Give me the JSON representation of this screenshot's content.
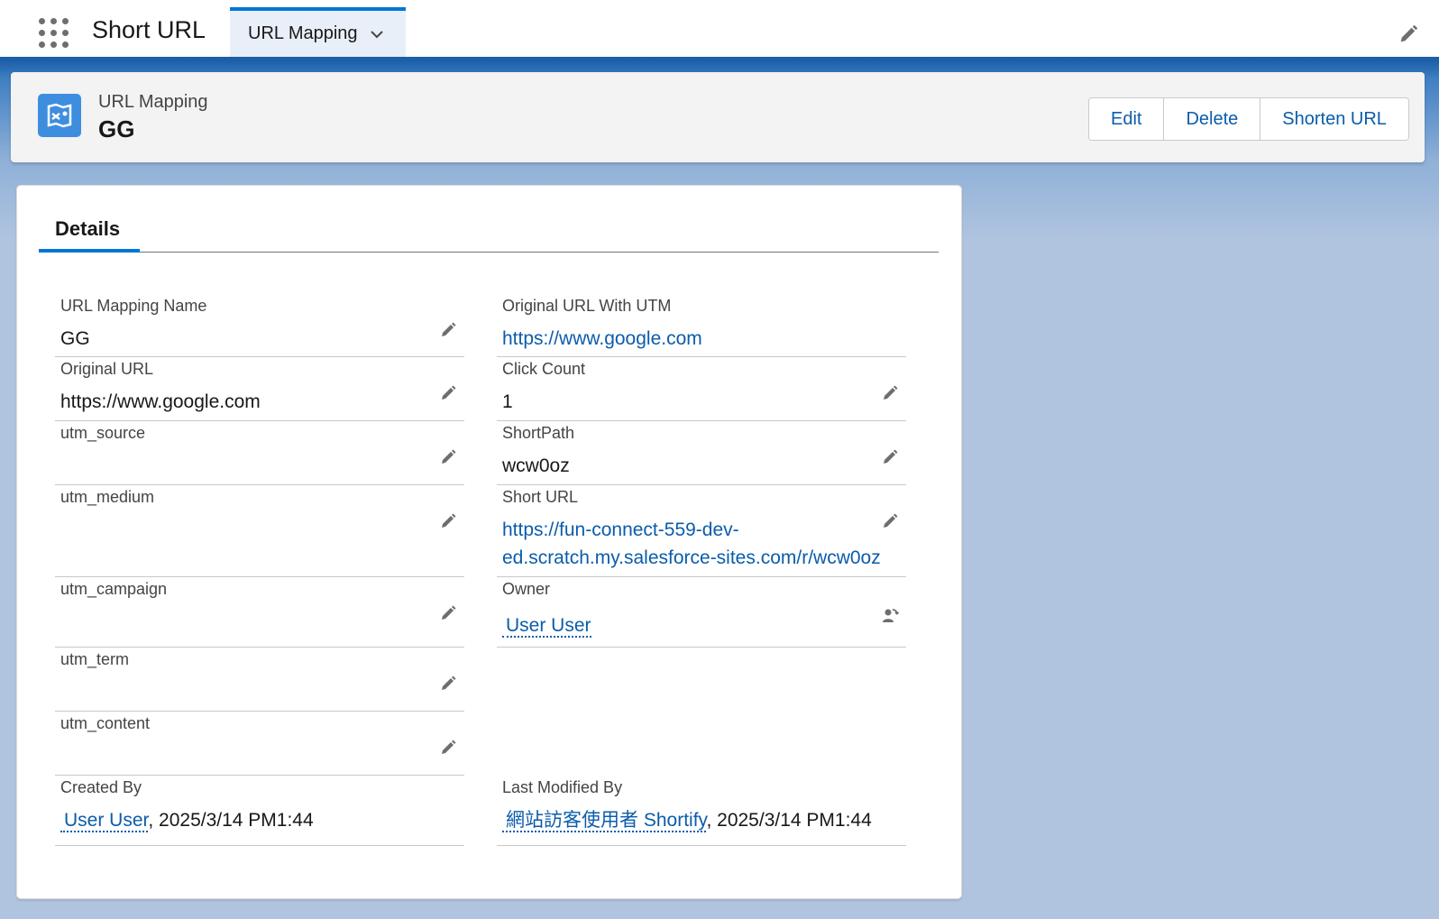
{
  "app": {
    "name": "Short URL",
    "nav_tab_label": "URL Mapping"
  },
  "record": {
    "type_label": "URL Mapping",
    "name": "GG",
    "actions": [
      "Edit",
      "Delete",
      "Shorten URL"
    ]
  },
  "details": {
    "tab_label": "Details",
    "left": {
      "url_mapping_name": {
        "label": "URL Mapping Name",
        "value": "GG"
      },
      "original_url": {
        "label": "Original URL",
        "value": "https://www.google.com"
      },
      "utm_source": {
        "label": "utm_source",
        "value": ""
      },
      "utm_medium": {
        "label": "utm_medium",
        "value": ""
      },
      "utm_campaign": {
        "label": "utm_campaign",
        "value": ""
      },
      "utm_term": {
        "label": "utm_term",
        "value": ""
      },
      "utm_content": {
        "label": "utm_content",
        "value": ""
      },
      "created_by": {
        "label": "Created By",
        "user": "User User",
        "timestamp": ", 2025/3/14 PM1:44"
      }
    },
    "right": {
      "original_url_with_utm": {
        "label": "Original URL With UTM",
        "value": "https://www.google.com"
      },
      "click_count": {
        "label": "Click Count",
        "value": "1"
      },
      "short_path": {
        "label": "ShortPath",
        "value": "wcw0oz"
      },
      "short_url": {
        "label": "Short URL",
        "line1": "https://fun-connect-559-dev-",
        "line2": "ed.scratch.my.salesforce-sites.com/r/wcw0oz"
      },
      "owner": {
        "label": "Owner",
        "value": "User User"
      },
      "last_modified_by": {
        "label": "Last Modified By",
        "user": "網站訪客使用者 Shortify",
        "timestamp": ", 2025/3/14 PM1:44"
      }
    }
  },
  "colors": {
    "brand": "#0176d3",
    "link": "#0b5cab",
    "header_bar": "#1b5fa8",
    "record_icon": "#3e8ee0"
  },
  "icons": [
    "app-launcher-icon",
    "chevron-down-icon",
    "pencil-icon",
    "url-mapping-icon",
    "change-owner-icon"
  ]
}
